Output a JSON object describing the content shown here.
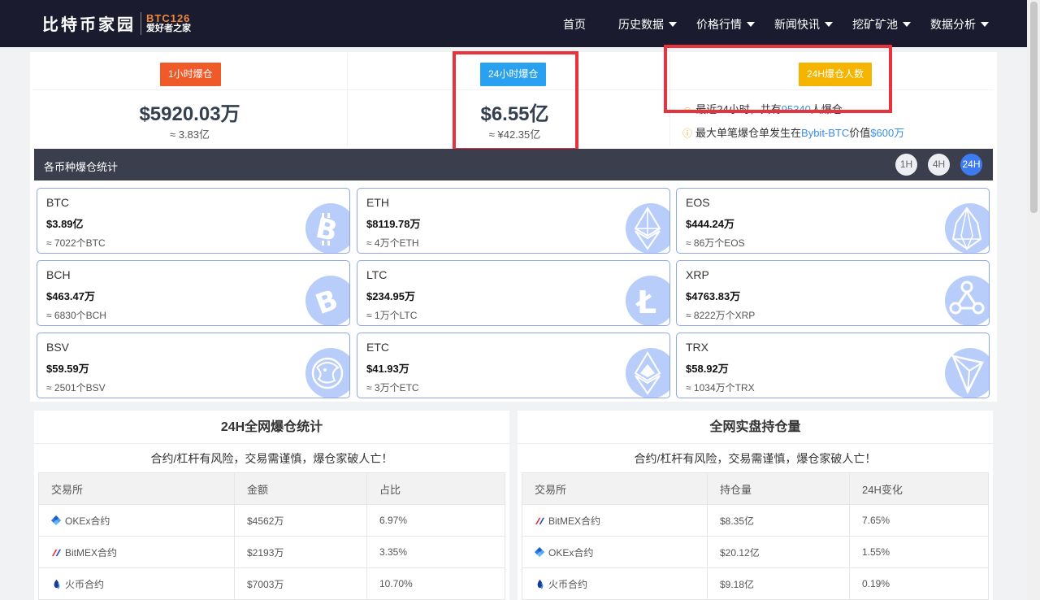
{
  "nav": {
    "logo_text": "比特币家园",
    "logo_code": "BTC126",
    "logo_slogan": "爱好者之家",
    "items": [
      "首页",
      "历史数据",
      "价格行情",
      "新闻快讯",
      "挖矿矿池",
      "数据分析"
    ]
  },
  "summary": {
    "h1": {
      "badge": "1小时爆仓",
      "value": "$5920.03万",
      "sub": "≈ 3.83亿",
      "badge_color": "#f05a28"
    },
    "h24": {
      "badge": "24小时爆仓",
      "value": "$6.55亿",
      "sub": "≈ ¥42.35亿",
      "badge_color": "#2aa0f0"
    },
    "people": {
      "badge": "24H爆仓人数",
      "badge_color": "#f5b400",
      "line1_pre": "最近24小时，共有",
      "line1_num": "95340",
      "line1_post": "人爆仓",
      "line2_pre": "最大单笔爆仓单发生在",
      "line2_ex": "Bybit-BTC",
      "line2_mid": "价值",
      "line2_amt": "$600万"
    }
  },
  "coins_section": {
    "title": "各币种爆仓统计",
    "timeframes": [
      "1H",
      "4H",
      "24H"
    ],
    "active_timeframe": "24H",
    "coins": [
      {
        "symbol": "BTC",
        "value": "$3.89亿",
        "sub": "≈ 7022个BTC",
        "icon": "bitcoin-icon"
      },
      {
        "symbol": "ETH",
        "value": "$8119.78万",
        "sub": "≈ 4万个ETH",
        "icon": "ethereum-icon"
      },
      {
        "symbol": "EOS",
        "value": "$444.24万",
        "sub": "≈ 86万个EOS",
        "icon": "eos-icon"
      },
      {
        "symbol": "BCH",
        "value": "$463.47万",
        "sub": "≈ 6830个BCH",
        "icon": "bitcoin-cash-icon"
      },
      {
        "symbol": "LTC",
        "value": "$234.95万",
        "sub": "≈ 1万个LTC",
        "icon": "litecoin-icon"
      },
      {
        "symbol": "XRP",
        "value": "$4763.83万",
        "sub": "≈ 8222万个XRP",
        "icon": "ripple-icon"
      },
      {
        "symbol": "BSV",
        "value": "$59.59万",
        "sub": "≈ 2501个BSV",
        "icon": "bsv-dragon-icon"
      },
      {
        "symbol": "ETC",
        "value": "$41.93万",
        "sub": "≈ 3万个ETC",
        "icon": "ethereum-classic-icon"
      },
      {
        "symbol": "TRX",
        "value": "$58.92万",
        "sub": "≈ 1034万个TRX",
        "icon": "tron-icon"
      }
    ]
  },
  "left_table": {
    "title": "24H全网爆仓统计",
    "warning": "合约/杠杆有风险，交易需谨慎，爆仓家破人亡！",
    "headers": [
      "交易所",
      "金额",
      "占比"
    ],
    "rows": [
      {
        "exchange": "OKEx合约",
        "amount": "$4562万",
        "ratio": "6.97%",
        "icon": "okex-icon"
      },
      {
        "exchange": "BitMEX合约",
        "amount": "$2193万",
        "ratio": "3.35%",
        "icon": "bitmex-icon"
      },
      {
        "exchange": "火币合约",
        "amount": "$7003万",
        "ratio": "10.70%",
        "icon": "huobi-icon"
      }
    ]
  },
  "right_table": {
    "title": "全网实盘持仓量",
    "warning": "合约/杠杆有风险，交易需谨慎，爆仓家破人亡！",
    "headers": [
      "交易所",
      "持仓量",
      "24H变化"
    ],
    "rows": [
      {
        "exchange": "BitMEX合约",
        "amount": "$8.35亿",
        "ratio": "7.65%",
        "icon": "bitmex-icon"
      },
      {
        "exchange": "OKEx合约",
        "amount": "$20.12亿",
        "ratio": "1.55%",
        "icon": "okex-icon"
      },
      {
        "exchange": "火币合约",
        "amount": "$9.18亿",
        "ratio": "0.19%",
        "icon": "huobi-icon"
      }
    ]
  }
}
